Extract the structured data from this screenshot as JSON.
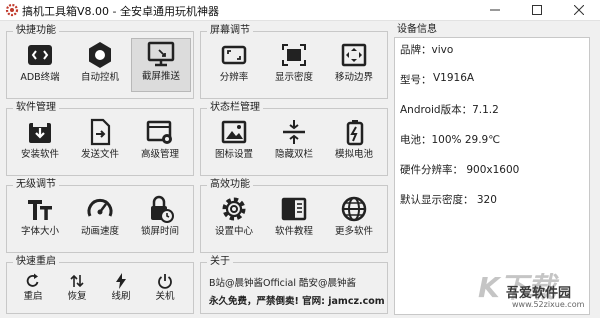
{
  "window": {
    "title": "搞机工具箱V8.00 - 全安卓通用玩机神器",
    "icon": "app-gear-icon",
    "controls": [
      "minimize-icon",
      "maximize-icon",
      "close-icon"
    ]
  },
  "groups": {
    "quick": {
      "title": "快捷功能",
      "items": [
        {
          "label": "ADB终端",
          "icon": "terminal-icon"
        },
        {
          "label": "自动控机",
          "icon": "hexagon-icon"
        },
        {
          "label": "截屏推送",
          "icon": "screen-cast-icon"
        }
      ]
    },
    "screen": {
      "title": "屏幕调节",
      "items": [
        {
          "label": "分辨率",
          "icon": "resolution-icon"
        },
        {
          "label": "显示密度",
          "icon": "density-icon"
        },
        {
          "label": "移动边界",
          "icon": "move-border-icon"
        }
      ]
    },
    "software": {
      "title": "软件管理",
      "items": [
        {
          "label": "安装软件",
          "icon": "install-icon"
        },
        {
          "label": "发送文件",
          "icon": "send-file-icon"
        },
        {
          "label": "高级管理",
          "icon": "advanced-manage-icon"
        }
      ]
    },
    "statusbar": {
      "title": "状态栏管理",
      "items": [
        {
          "label": "图标设置",
          "icon": "image-icon"
        },
        {
          "label": "隐藏双栏",
          "icon": "hide-bars-icon"
        },
        {
          "label": "模拟电池",
          "icon": "battery-icon"
        }
      ]
    },
    "wireless": {
      "title": "无级调节",
      "items": [
        {
          "label": "字体大小",
          "icon": "font-size-icon"
        },
        {
          "label": "动画速度",
          "icon": "speedometer-icon"
        },
        {
          "label": "锁屏时间",
          "icon": "lock-timer-icon"
        }
      ]
    },
    "advanced": {
      "title": "高效功能",
      "items": [
        {
          "label": "设置中心",
          "icon": "gear-icon"
        },
        {
          "label": "软件教程",
          "icon": "book-icon"
        },
        {
          "label": "更多软件",
          "icon": "globe-icon"
        }
      ]
    },
    "reboot": {
      "title": "快速重启",
      "items": [
        {
          "label": "重启",
          "icon": "restart-icon"
        },
        {
          "label": "恢复",
          "icon": "recovery-icon"
        },
        {
          "label": "线刷",
          "icon": "flash-icon"
        },
        {
          "label": "关机",
          "icon": "power-icon"
        }
      ]
    },
    "about": {
      "title": "关于",
      "line1": "B站@晨钟酱Official  酷安@晨钟酱",
      "line2": "永久免费，严禁倒卖! 官网: jamcz.com"
    }
  },
  "device": {
    "title": "设备信息",
    "brand": "品牌：vivo",
    "model_label": "型号：",
    "model": "V1916A",
    "android": "Android版本：7.1.2",
    "battery": "电池：100%  29.9℃",
    "hw_resolution": "硬件分辨率：  900x1600",
    "density": "默认显示密度：  320"
  },
  "watermark": {
    "big": "K下载",
    "name": "吾爱软件园",
    "url": "www.52zixue.com"
  }
}
